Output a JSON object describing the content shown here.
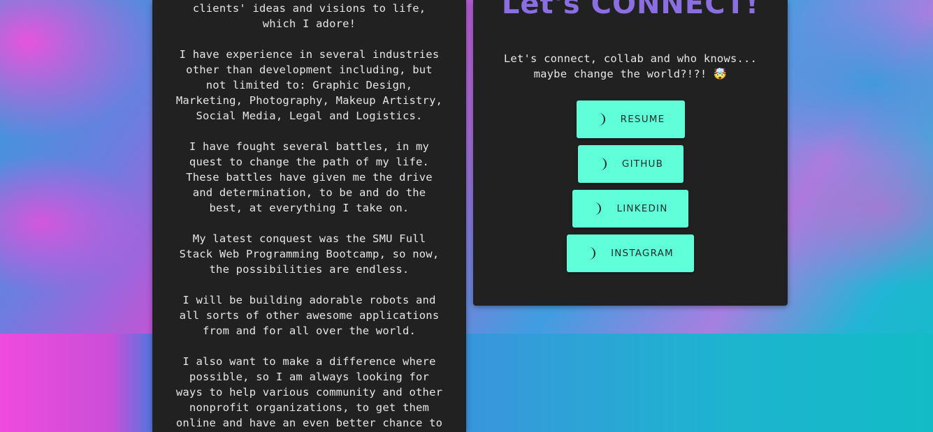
{
  "about": {
    "paragraphs": [
      "clients' ideas and visions to life, which I adore!",
      "I have experience in several industries other than development including, but not limited to: Graphic Design, Marketing, Photography, Makeup Artistry, Social Media, Legal and Logistics.",
      "I have fought several battles, in my quest to change the path of my life. These battles have given me the drive and determination, to be and do the best, at everything I take on.",
      "My latest conquest was the SMU Full Stack Web Programming Bootcamp, so now, the possibilities are endless.",
      "I will be building adorable robots and all sorts of other awesome applications from and for all over the world.",
      "I also want to make a difference where possible, so I am always looking for ways to help various community and other nonprofit organizations, to get them online and have an even better chance to"
    ]
  },
  "connect": {
    "title": "Let's CONNECT!",
    "blurb": "Let's connect, collab and who knows... maybe change the world?!?! 🤯",
    "buttons": {
      "resume": "RESUME",
      "github": "GITHUB",
      "linkedin": "LINKEDIN",
      "instagram": "INSTAGRAM"
    },
    "button_icon": "crescent-moon-icon"
  },
  "colors": {
    "panel_bg": "#212121",
    "button_bg": "#5effd9",
    "title_color": "#8b6fe2",
    "text_color": "#e6e6e6"
  }
}
